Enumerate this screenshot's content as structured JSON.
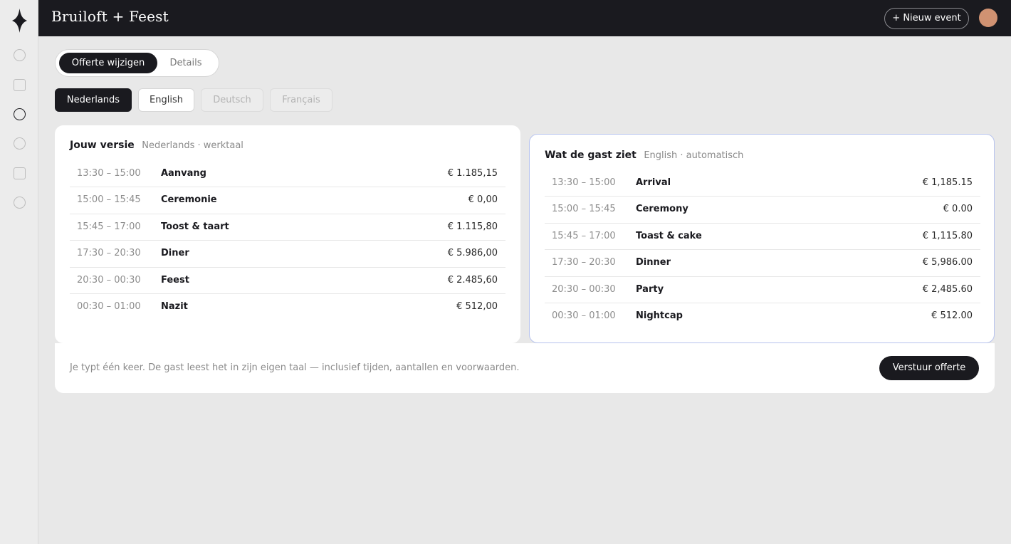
{
  "app": {
    "title": "Bruiloft + Feest"
  },
  "header": {
    "new_event_label": "+ Nieuw event"
  },
  "mode_toggle": {
    "active": "Offerte wijzigen",
    "inactive": "Details"
  },
  "languages": [
    "Nederlands",
    "English",
    "Deutsch",
    "Français"
  ],
  "left_card": {
    "title": "Jouw versie",
    "subtitle": "Nederlands · werktaal",
    "rows": [
      {
        "time": "13:30 – 15:00",
        "name": "Aanvang",
        "price": "€ 1.185,15"
      },
      {
        "time": "15:00 – 15:45",
        "name": "Ceremonie",
        "price": "€ 0,00"
      },
      {
        "time": "15:45 – 17:00",
        "name": "Toost & taart",
        "price": "€ 1.115,80"
      },
      {
        "time": "17:30 – 20:30",
        "name": "Diner",
        "price": "€ 5.986,00"
      },
      {
        "time": "20:30 – 00:30",
        "name": "Feest",
        "price": "€ 2.485,60"
      },
      {
        "time": "00:30 – 01:00",
        "name": "Nazit",
        "price": "€ 512,00"
      }
    ]
  },
  "right_card": {
    "title": "Wat de gast ziet",
    "subtitle": "English · automatisch",
    "rows": [
      {
        "time": "13:30 – 15:00",
        "name": "Arrival",
        "price": "€ 1,185.15"
      },
      {
        "time": "15:00 – 15:45",
        "name": "Ceremony",
        "price": "€ 0.00"
      },
      {
        "time": "15:45 – 17:00",
        "name": "Toast & cake",
        "price": "€ 1,115.80"
      },
      {
        "time": "17:30 – 20:30",
        "name": "Dinner",
        "price": "€ 5,986.00"
      },
      {
        "time": "20:30 – 00:30",
        "name": "Party",
        "price": "€ 2,485.60"
      },
      {
        "time": "00:30 – 01:00",
        "name": "Nightcap",
        "price": "€ 512.00"
      }
    ]
  },
  "footer": {
    "note": "Je typt één keer. De gast leest het in zijn eigen taal — inclusief tijden, aantallen en voorwaarden.",
    "send_label": "Verstuur offerte"
  },
  "colors": {
    "dark": "#1a1a1f",
    "avatar": "#d09272",
    "accent_border": "#b7c3ee"
  }
}
